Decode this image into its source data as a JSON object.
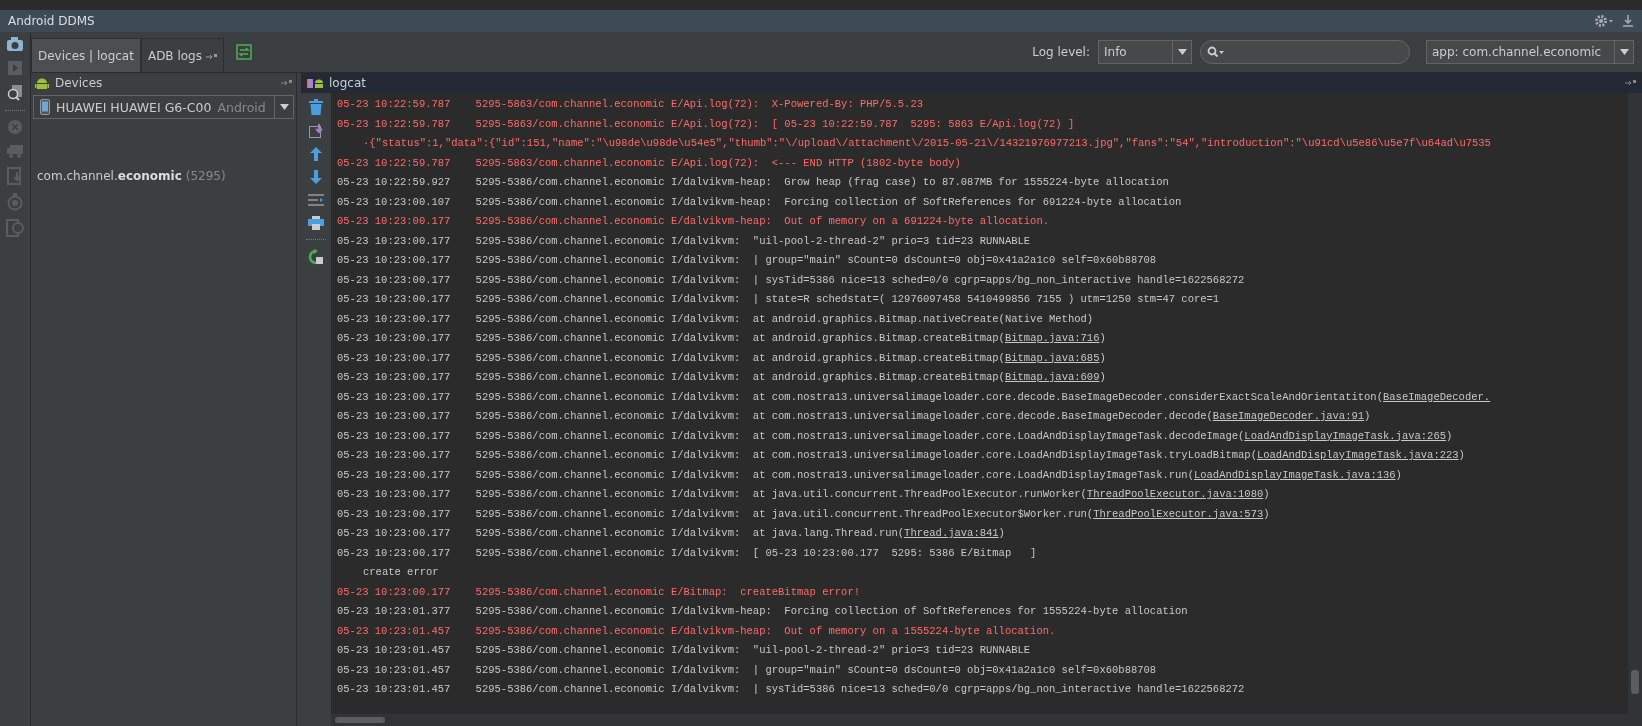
{
  "window": {
    "title": "Android DDMS"
  },
  "tabs": [
    {
      "label": "Devices | logcat",
      "selected": true
    },
    {
      "label": "ADB logs",
      "selected": false
    }
  ],
  "toolbar": {
    "log_level_label": "Log level:",
    "log_level": "Info",
    "filter": "app: com.channel.economic"
  },
  "devices": {
    "title": "Devices",
    "device": "HUAWEI HUAWEI G6-C00",
    "device_version": "Android",
    "process": "com.channel.**economic**",
    "pid": "(5295)"
  },
  "logcat": {
    "title": "logcat",
    "lines": [
      {
        "kind": "entry",
        "error": true,
        "text": "05-23 10:22:59.787    5295-5863/com.channel.economic E/Api.log(72):  X-Powered-By: PHP/5.5.23"
      },
      {
        "kind": "entry",
        "error": true,
        "text": "05-23 10:22:59.787    5295-5863/com.channel.economic E/Api.log(72):  [ 05-23 10:22:59.787  5295: 5863 E/Api.log(72) ]"
      },
      {
        "kind": "continuation",
        "error": true,
        "text": "·{\"status\":1,\"data\":{\"id\":151,\"name\":\"\\u98de\\u98de\\u54e5\",\"thumb\":\"\\/upload\\/attachment\\/2015-05-21\\/14321976977213.jpg\",\"fans\":\"54\",\"introduction\":\"\\u91cd\\u5e86\\u5e7f\\u64ad\\u7535"
      },
      {
        "kind": "entry",
        "error": true,
        "text": "05-23 10:22:59.787    5295-5863/com.channel.economic E/Api.log(72):  <--- END HTTP (1802-byte body)"
      },
      {
        "kind": "entry",
        "error": false,
        "text": "05-23 10:22:59.927    5295-5386/com.channel.economic I/dalvikvm-heap:  Grow heap (frag case) to 87.087MB for 1555224-byte allocation"
      },
      {
        "kind": "entry",
        "error": false,
        "text": "05-23 10:23:00.107    5295-5386/com.channel.economic I/dalvikvm-heap:  Forcing collection of SoftReferences for 691224-byte allocation"
      },
      {
        "kind": "entry",
        "error": true,
        "text": "05-23 10:23:00.177    5295-5386/com.channel.economic E/dalvikvm-heap:  Out of memory on a 691224-byte allocation."
      },
      {
        "kind": "entry",
        "error": false,
        "text": "05-23 10:23:00.177    5295-5386/com.channel.economic I/dalvikvm:  \"uil-pool-2-thread-2\" prio=3 tid=23 RUNNABLE"
      },
      {
        "kind": "entry",
        "error": false,
        "text": "05-23 10:23:00.177    5295-5386/com.channel.economic I/dalvikvm:  | group=\"main\" sCount=0 dsCount=0 obj=0x41a2a1c0 self=0x60b88708"
      },
      {
        "kind": "entry",
        "error": false,
        "text": "05-23 10:23:00.177    5295-5386/com.channel.economic I/dalvikvm:  | sysTid=5386 nice=13 sched=0/0 cgrp=apps/bg_non_interactive handle=1622568272"
      },
      {
        "kind": "entry",
        "error": false,
        "text": "05-23 10:23:00.177    5295-5386/com.channel.economic I/dalvikvm:  | state=R schedstat=( 12976097458 5410499856 7155 ) utm=1250 stm=47 core=1"
      },
      {
        "kind": "entry",
        "error": false,
        "text": "05-23 10:23:00.177    5295-5386/com.channel.economic I/dalvikvm:  at android.graphics.Bitmap.nativeCreate(Native Method)"
      },
      {
        "kind": "entry",
        "error": false,
        "text": "05-23 10:23:00.177    5295-5386/com.channel.economic I/dalvikvm:  at android.graphics.Bitmap.createBitmap(",
        "link": "Bitmap.java:716",
        "tail": ")"
      },
      {
        "kind": "entry",
        "error": false,
        "text": "05-23 10:23:00.177    5295-5386/com.channel.economic I/dalvikvm:  at android.graphics.Bitmap.createBitmap(",
        "link": "Bitmap.java:685",
        "tail": ")"
      },
      {
        "kind": "entry",
        "error": false,
        "text": "05-23 10:23:00.177    5295-5386/com.channel.economic I/dalvikvm:  at android.graphics.Bitmap.createBitmap(",
        "link": "Bitmap.java:609",
        "tail": ")"
      },
      {
        "kind": "entry",
        "error": false,
        "text": "05-23 10:23:00.177    5295-5386/com.channel.economic I/dalvikvm:  at com.nostra13.universalimageloader.core.decode.BaseImageDecoder.considerExactScaleAndOrientatiton(",
        "link": "BaseImageDecoder."
      },
      {
        "kind": "entry",
        "error": false,
        "text": "05-23 10:23:00.177    5295-5386/com.channel.economic I/dalvikvm:  at com.nostra13.universalimageloader.core.decode.BaseImageDecoder.decode(",
        "link": "BaseImageDecoder.java:91",
        "tail": ")"
      },
      {
        "kind": "entry",
        "error": false,
        "text": "05-23 10:23:00.177    5295-5386/com.channel.economic I/dalvikvm:  at com.nostra13.universalimageloader.core.LoadAndDisplayImageTask.decodeImage(",
        "link": "LoadAndDisplayImageTask.java:265",
        "tail": ")"
      },
      {
        "kind": "entry",
        "error": false,
        "text": "05-23 10:23:00.177    5295-5386/com.channel.economic I/dalvikvm:  at com.nostra13.universalimageloader.core.LoadAndDisplayImageTask.tryLoadBitmap(",
        "link": "LoadAndDisplayImageTask.java:223",
        "tail": ")"
      },
      {
        "kind": "entry",
        "error": false,
        "text": "05-23 10:23:00.177    5295-5386/com.channel.economic I/dalvikvm:  at com.nostra13.universalimageloader.core.LoadAndDisplayImageTask.run(",
        "link": "LoadAndDisplayImageTask.java:136",
        "tail": ")"
      },
      {
        "kind": "entry",
        "error": false,
        "text": "05-23 10:23:00.177    5295-5386/com.channel.economic I/dalvikvm:  at java.util.concurrent.ThreadPoolExecutor.runWorker(",
        "link": "ThreadPoolExecutor.java:1080",
        "tail": ")"
      },
      {
        "kind": "entry",
        "error": false,
        "text": "05-23 10:23:00.177    5295-5386/com.channel.economic I/dalvikvm:  at java.util.concurrent.ThreadPoolExecutor$Worker.run(",
        "link": "ThreadPoolExecutor.java:573",
        "tail": ")"
      },
      {
        "kind": "entry",
        "error": false,
        "text": "05-23 10:23:00.177    5295-5386/com.channel.economic I/dalvikvm:  at java.lang.Thread.run(",
        "link": "Thread.java:841",
        "tail": ")"
      },
      {
        "kind": "entry",
        "error": false,
        "text": "05-23 10:23:00.177    5295-5386/com.channel.economic I/dalvikvm:  [ 05-23 10:23:00.177  5295: 5386 E/Bitmap   ]"
      },
      {
        "kind": "continuation",
        "error": false,
        "text": "create error"
      },
      {
        "kind": "entry",
        "error": true,
        "text": "05-23 10:23:00.177    5295-5386/com.channel.economic E/Bitmap:  createBitmap error!"
      },
      {
        "kind": "entry",
        "error": false,
        "text": "05-23 10:23:01.377    5295-5386/com.channel.economic I/dalvikvm-heap:  Forcing collection of SoftReferences for 1555224-byte allocation"
      },
      {
        "kind": "entry",
        "error": true,
        "text": "05-23 10:23:01.457    5295-5386/com.channel.economic E/dalvikvm-heap:  Out of memory on a 1555224-byte allocation."
      },
      {
        "kind": "entry",
        "error": false,
        "text": "05-23 10:23:01.457    5295-5386/com.channel.economic I/dalvikvm:  \"uil-pool-2-thread-2\" prio=3 tid=23 RUNNABLE"
      },
      {
        "kind": "entry",
        "error": false,
        "text": "05-23 10:23:01.457    5295-5386/com.channel.economic I/dalvikvm:  | group=\"main\" sCount=0 dsCount=0 obj=0x41a2a1c0 self=0x60b88708"
      },
      {
        "kind": "entry",
        "error": false,
        "text": "05-23 10:23:01.457    5295-5386/com.channel.economic I/dalvikvm:  | sysTid=5386 nice=13 sched=0/0 cgrp=apps/bg_non_interactive handle=1622568272"
      }
    ]
  }
}
